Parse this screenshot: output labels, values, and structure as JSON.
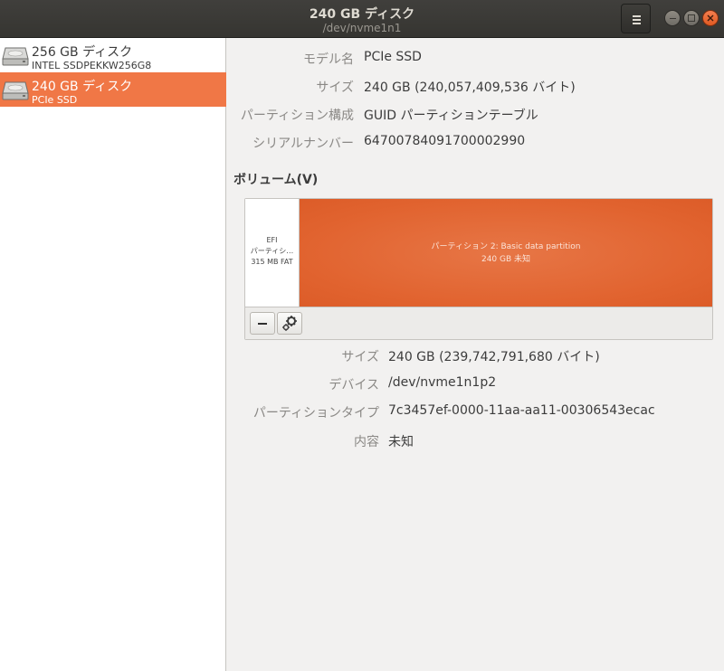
{
  "window": {
    "title": "240 GB ディスク",
    "subtitle": "/dev/nvme1n1"
  },
  "sidebar": {
    "drives": [
      {
        "name": "256 GB ディスク",
        "model": "INTEL SSDPEKKW256G8",
        "selected": false,
        "icon": "hard-drive-icon"
      },
      {
        "name": "240 GB ディスク",
        "model": "PCIe SSD",
        "selected": true,
        "icon": "hard-drive-icon"
      }
    ]
  },
  "disk_info": {
    "model_label": "モデル名",
    "model_value": "PCIe SSD",
    "size_label": "サイズ",
    "size_value": "240 GB (240,057,409,536 バイト)",
    "partitioning_label": "パーティション構成",
    "partitioning_value": "GUID パーティションテーブル",
    "serial_label": "シリアルナンバー",
    "serial_value": "64700784091700002990"
  },
  "volumes": {
    "title": "ボリューム(V)",
    "partitions": [
      {
        "line1": "EFI",
        "line2": "パーティシ…",
        "line3": "315 MB FAT"
      },
      {
        "line1": "パーティション 2: Basic data partition",
        "line2": "240 GB 未知"
      }
    ],
    "toolbar": {
      "remove_icon": "minus-icon",
      "settings_icon": "gears-icon"
    }
  },
  "partition_info": {
    "size_label": "サイズ",
    "size_value": "240 GB (239,742,791,680 バイト)",
    "device_label": "デバイス",
    "device_value": "/dev/nvme1n1p2",
    "type_label": "パーティションタイプ",
    "type_value": "7c3457ef-0000-11aa-aa11-00306543ecac",
    "contents_label": "内容",
    "contents_value": "未知"
  },
  "colors": {
    "accent": "#f07746",
    "partition_fill": "#e1632f",
    "titlebar": "#3b3a36"
  }
}
